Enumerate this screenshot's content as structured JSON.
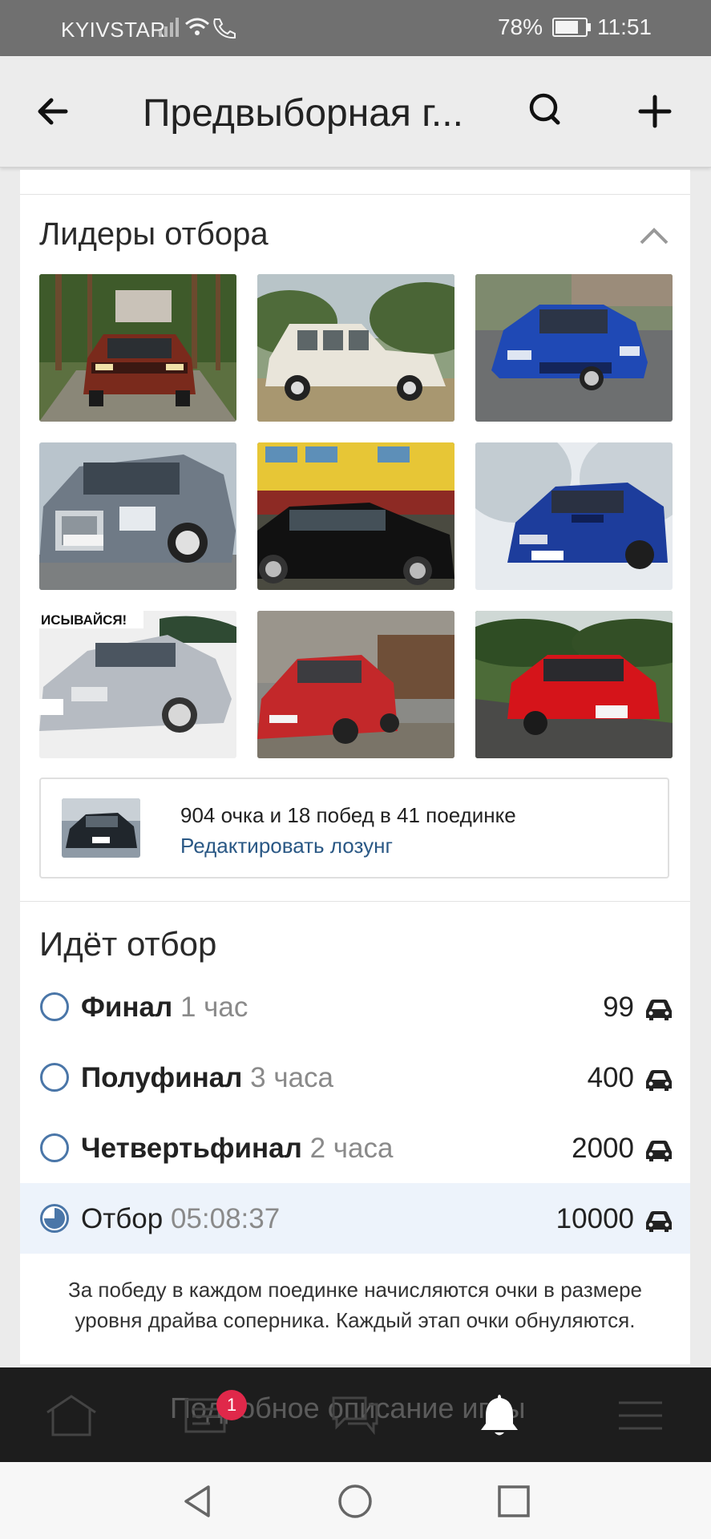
{
  "status_bar": {
    "carrier": "KYIVSTAR",
    "battery": "78%",
    "time": "11:51"
  },
  "header": {
    "title": "Предвыборная г...",
    "back_icon": "arrow-left-icon",
    "search_icon": "search-icon",
    "add_icon": "plus-icon"
  },
  "leaders": {
    "title": "Лидеры отбора",
    "collapse_icon": "chevron-up-icon",
    "photos": [
      {
        "name": "car-photo-audi",
        "banner": ""
      },
      {
        "name": "car-photo-volga",
        "banner": ""
      },
      {
        "name": "car-photo-vw-blue",
        "banner": ""
      },
      {
        "name": "car-photo-mercedes",
        "banner": ""
      },
      {
        "name": "car-photo-bmw",
        "banner": ""
      },
      {
        "name": "car-photo-subaru",
        "banner": ""
      },
      {
        "name": "car-photo-volvo",
        "banner": "ИСЫВАЙСЯ!"
      },
      {
        "name": "car-photo-golf-red",
        "banner": ""
      },
      {
        "name": "car-photo-lancer",
        "banner": ""
      }
    ]
  },
  "slogan": {
    "stats": "904 очка и 18 побед в 41 поединке",
    "edit_label": "Редактировать лозунг"
  },
  "selection": {
    "title": "Идёт отбор",
    "stages": [
      {
        "name": "Финал",
        "duration": "1 час",
        "count": "99",
        "active": false
      },
      {
        "name": "Полуфинал",
        "duration": "3 часа",
        "count": "400",
        "active": false
      },
      {
        "name": "Четвертьфинал",
        "duration": "2 часа",
        "count": "2000",
        "active": false
      },
      {
        "name": "Отбор",
        "duration": "05:08:37",
        "count": "10000",
        "active": true
      }
    ],
    "note": "За победу в каждом поединке начисляются очки в размере уровня драйва соперника. Каждый этап очки обнуляются."
  },
  "tabbar": {
    "ghost_text": "Подробное описание игры",
    "badge": "1",
    "icons": [
      "home-icon",
      "news-icon",
      "messages-icon",
      "bell-icon",
      "menu-icon"
    ]
  },
  "colors": {
    "link": "#2a5885",
    "accent": "#4a76a8",
    "badge": "#e0284a",
    "active_row": "#edf3fb"
  }
}
